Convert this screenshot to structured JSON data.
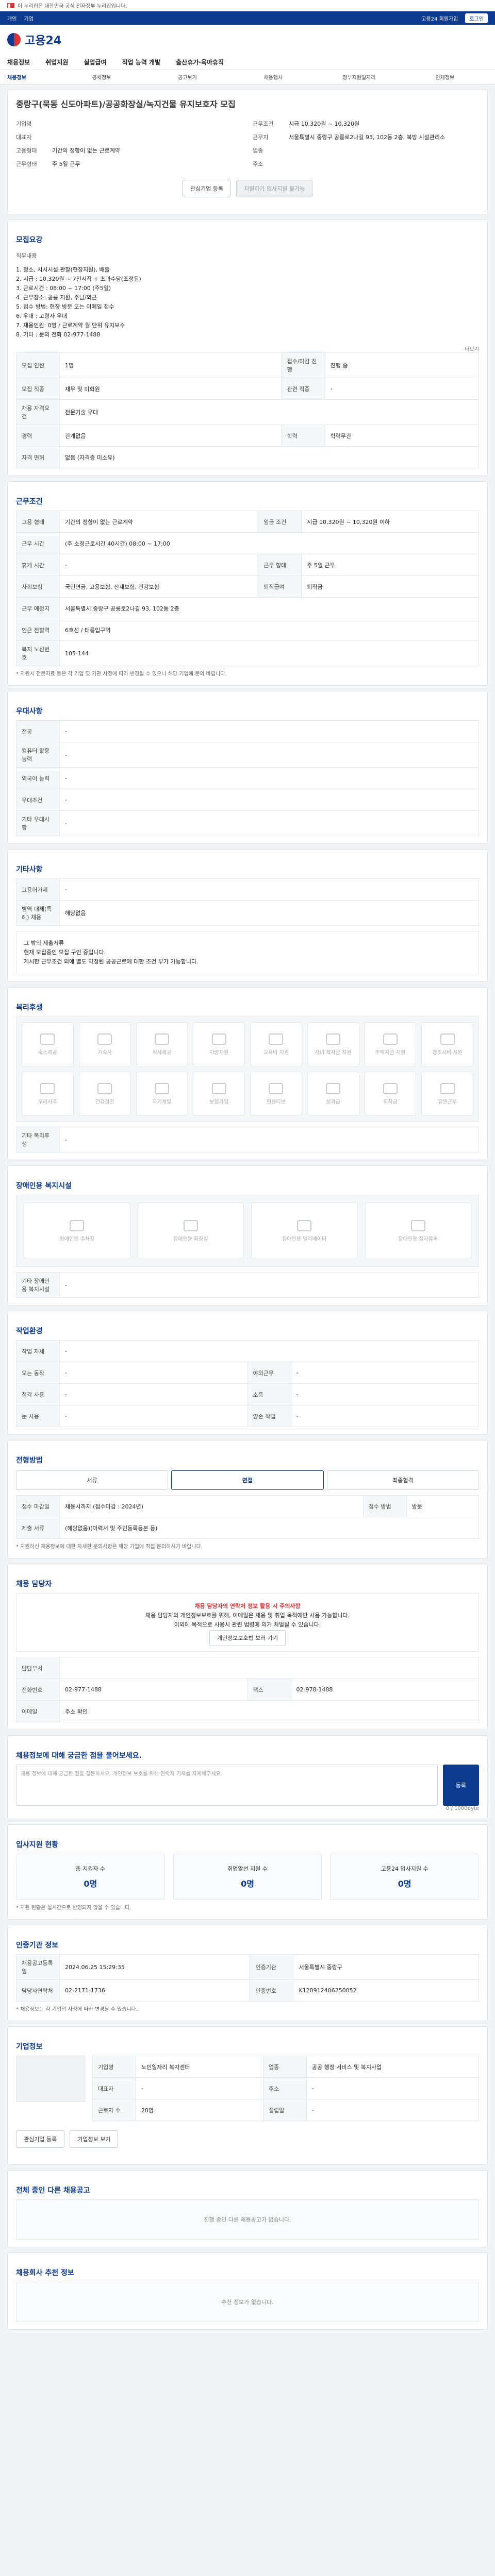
{
  "notice": {
    "text": "이 누리집은 대한민국 공식 전자정부 누리집입니다."
  },
  "topbar": {
    "items": [
      "개인",
      "기업"
    ],
    "right": "고용24 회원가입",
    "btn": "로그인"
  },
  "brand": {
    "name": "고용24"
  },
  "gnb": [
    "채용정보",
    "취업지원",
    "실업급여",
    "직업 능력 개발",
    "출산휴가·육아휴직"
  ],
  "lnb": [
    "채용정보",
    "공채정보",
    "공고보기",
    "채용행사",
    "정부지원일자리",
    "인재정보"
  ],
  "job": {
    "title": "중랑구(묵동 신도아파트)/공공화장실/녹지건물 유지보호자 모집",
    "company_k": "기업명",
    "company": "",
    "industry_k": "업종",
    "industry": "",
    "rep_k": "대표자",
    "rep": "",
    "addr_k": "주소",
    "addr": "",
    "pay_k": "근무조건",
    "pay": "시급 10,320원 ~ 10,320원",
    "loc_k": "근무지",
    "loc": "서울특별시 중랑구 공릉로2나길 93, 102동 2층, 북방 시설관리소",
    "mgr_k": "고용형태",
    "mgr": "기간의 정함이 없는 근로계약",
    "place_k": "근무형태",
    "place": "주 5일 근무",
    "apply": "관심기업 등록",
    "share": "지원하기 입사지원 불가능"
  },
  "recruit": {
    "h": "모집요강",
    "job_k": "직무내용",
    "job_text": "1. 청소, 시시시설,관찰(현장지원), 배출\n2. 시급 : 10,320원 ~ 7천시작 + 초과수당(조정됨)\n3. 근로시간 : 08:00 ~ 17:00 (주5일)\n4. 근무장소: 공릉 지원, 주남/외근\n5. 접수 방법: 현장 방문 또는 이메일 접수\n6. 우대 : 고령자 우대\n7. 채용인원: 0명 / 근로계약 월 단위 유지보수\n8. 기타 : 문의 전화 02-977-1488",
    "more": "더보기"
  },
  "rtab": [
    [
      "모집 인원",
      "1명",
      "접수/마감 진행",
      "진행 중"
    ],
    [
      "모집 직종",
      "재무 및 미화원",
      "관련 직종",
      "-"
    ],
    [
      "채용 자격요건",
      "전문기술 우대",
      null,
      null
    ],
    [
      "경력",
      "관계없음",
      "학력",
      "학력무관"
    ],
    [
      "자격 면허",
      "없음 (자격증 미소유)",
      null,
      null
    ]
  ],
  "cond": {
    "h": "근무조건",
    "rows": [
      [
        "고용 형태",
        "기간의 정함이 없는 근로계약",
        "임금 조건",
        "시급 10,320원 ~ 10,320원 이하"
      ],
      [
        "근무 시간",
        "(주 소정근로시간 40시간) 08:00 ~ 17:00",
        "",
        ""
      ],
      [
        "휴게 시간",
        "-",
        "근무 형태",
        "주 5일 근무"
      ],
      [
        "사회보험",
        "국민연금, 고용보험, 산재보험, 건강보험",
        "퇴직급여",
        "퇴직금"
      ],
      [
        "근무 예정지",
        "서울특별시 중랑구 공릉로2나길 93, 102동 2층",
        "",
        ""
      ],
      [
        "인근 전철역",
        "6호선 / 태릉입구역",
        "",
        ""
      ],
      [
        "복지 노선번호",
        "105-144",
        "",
        ""
      ]
    ],
    "note": "* 지원시 전문자료 등은 각 기업 및 기관 사정에 따라 변경될 수 있으니 해당 기업에 문의 바랍니다."
  },
  "pref": {
    "h": "우대사항",
    "rows": [
      [
        "전공",
        "-"
      ],
      [
        "컴퓨터 활용 능력",
        "-"
      ],
      [
        "외국어 능력",
        "-"
      ],
      [
        "우대조건",
        "-"
      ],
      [
        "기타 우대사항",
        "-"
      ]
    ]
  },
  "etc": {
    "h": "기타사항",
    "rows": [
      [
        "고용허가제",
        "-"
      ],
      [
        "병역 대체(특례) 채용",
        "해당없음"
      ]
    ],
    "text": "그 밖의 제출서류\n현재 모집중인 모집 구인 중입니다.\n제시한 근무조건 외에 별도 약정된 공공근로에 대한 조건 부가 가능합니다."
  },
  "welfare": {
    "h": "복리후생",
    "items": [
      "숙소제공",
      "기숙사",
      "식사제공",
      "차량지원",
      "교육비 지원",
      "자녀 학자금 지원",
      "주택자금 지원",
      "경조사비 지원",
      "우리사주",
      "건강검진",
      "자기계발",
      "보험가입",
      "인센티브",
      "성과급",
      "퇴직금",
      "유연근무"
    ],
    "etc_k": "기타 복리후생",
    "etc": "-"
  },
  "disabled": {
    "h": "장애인용 복지시설",
    "items": [
      "장애인용 주차장",
      "장애인용 화장실",
      "장애인용 엘리베이터",
      "장애인용 점자블록"
    ],
    "etc_k": "기타 장애인용 복지시설",
    "etc": "-"
  },
  "env": {
    "h": "작업환경",
    "rows": [
      [
        "작업 자세",
        "-",
        "",
        ""
      ],
      [
        "오는 동작",
        "-",
        "야외근무",
        "-"
      ],
      [
        "청각 사용",
        "-",
        "소음",
        "-"
      ],
      [
        "눈 사용",
        "-",
        "양손 작업",
        "-"
      ]
    ]
  },
  "proc": {
    "h": "전형방법",
    "steps": [
      "서류",
      "면접",
      "최종합격"
    ],
    "k1": "접수 마감일",
    "v1": "채용시까지 (접수마감 : 2024년)",
    "k2": "접수 방법",
    "v2": "방문",
    "k3": "제출 서류",
    "v3": "(해당없음)(이력서 및 주민등록등본 등)",
    "notes": "* 지원하신 채용정보에 대한 자세한 문의사항은 해당 기업에 직접 문의하시기 바랍니다."
  },
  "contact": {
    "h": "채용 담당자",
    "warn_title": "채용 담당자의 연락처 정보 활용 시 주의사항",
    "warn1": "채용 담당자의 개인정보보호를 위해, 이메일은 채용 및 취업 목적에만 사용 가능합니다.",
    "warn2": "이외에 목적으로 사용시 관련 법령에 의거 처벌될 수 있습니다.",
    "btn": "개인정보보호법 보러 가기",
    "name_k": "담당부서",
    "tel_k": "전화번호",
    "tel": "02-977-1488",
    "fax_k": "팩스",
    "fax": "02-978-1488",
    "mail_k": "이메일",
    "mail": "주소 확인"
  },
  "qna": {
    "h": "채용정보에 대해 궁금한 점을 물어보세요.",
    "placeholder": "채용 정보에 대해 궁금한 점을 질문하세요. 개인정보 보호를 위해 연락처 기재를 자제해주세요.",
    "submit": "등록",
    "counter": "0 / 1000byte"
  },
  "stats": {
    "h": "입사지원 현황",
    "items": [
      [
        "총 지원자 수",
        "0명"
      ],
      [
        "취업알선 지원 수",
        "0명"
      ],
      [
        "고용24 입사지원 수",
        "0명"
      ]
    ],
    "note": "* 지원 현황은 실시간으로 반영되지 않을 수 있습니다."
  },
  "meta": {
    "h": "인증기관 정보",
    "rows": [
      [
        "채용공고등록일",
        "2024.06.25 15:29:35",
        "인증기관",
        "서울특별시 중랑구"
      ],
      [
        "담당자연락처",
        "02-2171-1736",
        "인증번호",
        "K120912406250052"
      ]
    ],
    "note": "* 채용정보는 각 기업의 사정에 따라 변경될 수 있습니다."
  },
  "company_info": {
    "h": "기업정보",
    "btn1": "관심기업 등록",
    "btn2": "기업정보 보기",
    "rows": [
      [
        "기업명",
        "노인일자리 복지센터"
      ],
      [
        "업종",
        "공공 행정 서비스 및 복지사업"
      ],
      [
        "대표자",
        "-"
      ],
      [
        "주소",
        "-"
      ],
      [
        "근로자 수",
        "20명"
      ],
      [
        "설립일",
        "-"
      ]
    ]
  },
  "related": {
    "h": "전체 중인 다른 채용공고",
    "empty": "진행 중인 다른 채용공고가 없습니다."
  },
  "recommend": {
    "h": "채용회사 추천 정보",
    "empty": "추천 정보가 없습니다."
  }
}
